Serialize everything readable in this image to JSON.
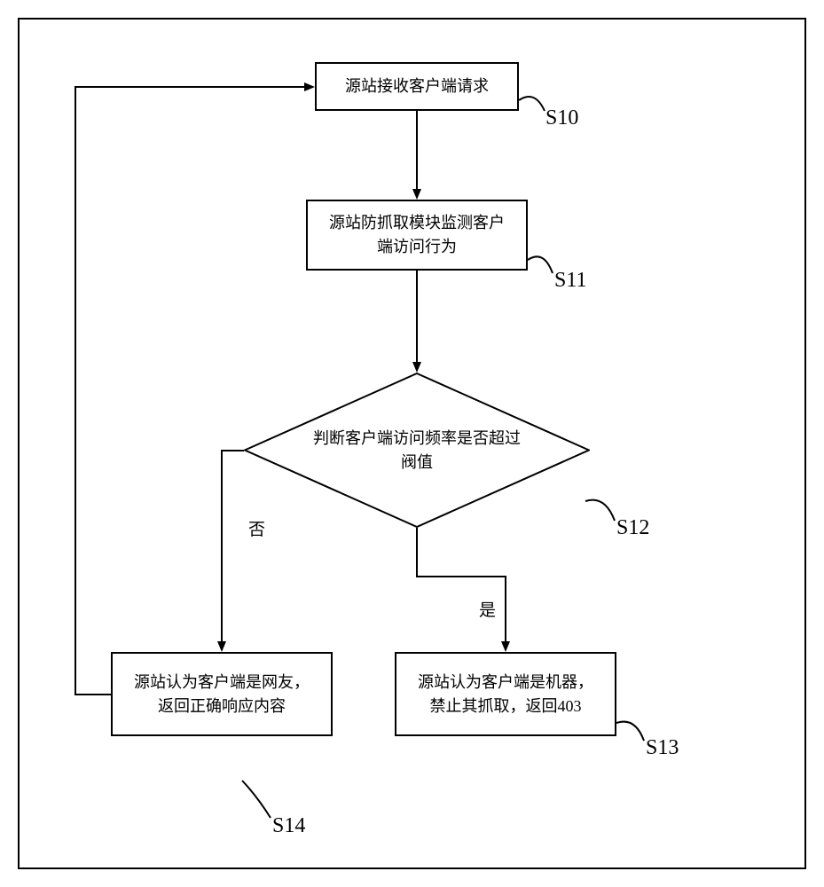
{
  "chart_data": {
    "type": "flowchart",
    "nodes": [
      {
        "id": "S10",
        "type": "process",
        "text": "源站接收客户端请求"
      },
      {
        "id": "S11",
        "type": "process",
        "text": "源站防抓取模块监测客户端访问行为"
      },
      {
        "id": "S12",
        "type": "decision",
        "text": "判断客户端访问频率是否超过阀值"
      },
      {
        "id": "S13",
        "type": "process",
        "text": "源站认为客户端是机器，禁止其抓取，返回403"
      },
      {
        "id": "S14",
        "type": "process",
        "text": "源站认为客户端是网友，返回正确响应内容"
      }
    ],
    "edges": [
      {
        "from": "S10",
        "to": "S11"
      },
      {
        "from": "S11",
        "to": "S12"
      },
      {
        "from": "S12",
        "to": "S13",
        "label": "是"
      },
      {
        "from": "S12",
        "to": "S14",
        "label": "否"
      },
      {
        "from": "S14",
        "to": "S10"
      }
    ]
  },
  "boxes": {
    "s10": "源站接收客户端请求",
    "s11_l1": "源站防抓取模块监测客户",
    "s11_l2": "端访问行为",
    "s12_l1": "判断客户端访问频率是否超过",
    "s12_l2": "阀值",
    "s13_l1": "源站认为客户端是机器，",
    "s13_l2": "禁止其抓取，返回403",
    "s14_l1": "源站认为客户端是网友，",
    "s14_l2": "返回正确响应内容"
  },
  "labels": {
    "s10": "S10",
    "s11": "S11",
    "s12": "S12",
    "s13": "S13",
    "s14": "S14",
    "yes": "是",
    "no": "否"
  }
}
